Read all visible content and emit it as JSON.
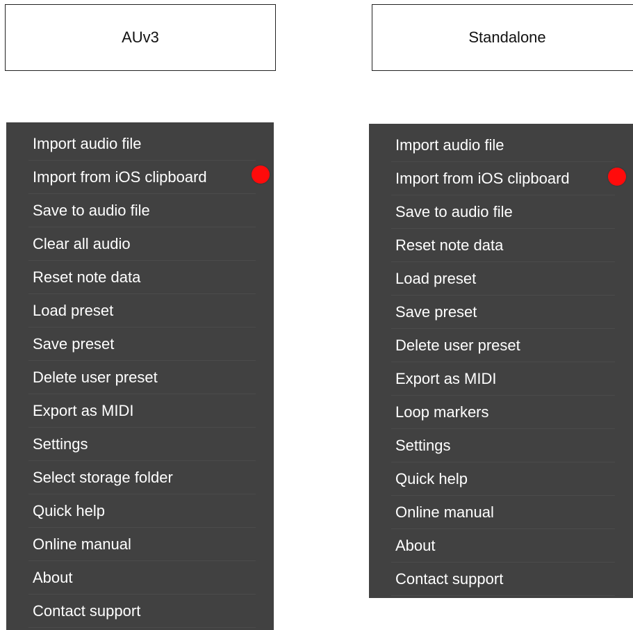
{
  "auv3": {
    "title": "AUv3",
    "items": [
      {
        "label": "Import audio file"
      },
      {
        "label": "Import from iOS clipboard"
      },
      {
        "label": "Save to audio file"
      },
      {
        "label": "Clear all audio"
      },
      {
        "label": "Reset note data"
      },
      {
        "label": "Load preset"
      },
      {
        "label": "Save preset"
      },
      {
        "label": "Delete user preset"
      },
      {
        "label": "Export as MIDI"
      },
      {
        "label": "Settings"
      },
      {
        "label": "Select storage folder"
      },
      {
        "label": "Quick help"
      },
      {
        "label": "Online manual"
      },
      {
        "label": "About"
      },
      {
        "label": "Contact support"
      }
    ]
  },
  "standalone": {
    "title": "Standalone",
    "items": [
      {
        "label": "Import audio file"
      },
      {
        "label": "Import from iOS clipboard"
      },
      {
        "label": "Save to audio file"
      },
      {
        "label": "Reset note data"
      },
      {
        "label": "Load preset"
      },
      {
        "label": "Save preset"
      },
      {
        "label": "Delete user preset"
      },
      {
        "label": "Export as MIDI"
      },
      {
        "label": "Loop markers"
      },
      {
        "label": "Settings"
      },
      {
        "label": "Quick help"
      },
      {
        "label": "Online manual"
      },
      {
        "label": "About"
      },
      {
        "label": "Contact support"
      }
    ]
  },
  "colors": {
    "menu_background": "#414141",
    "menu_text": "#ffffff",
    "highlight_dot": "#ff0b0b"
  },
  "icons": {
    "highlight_marker": "red-dot-marker-icon"
  }
}
